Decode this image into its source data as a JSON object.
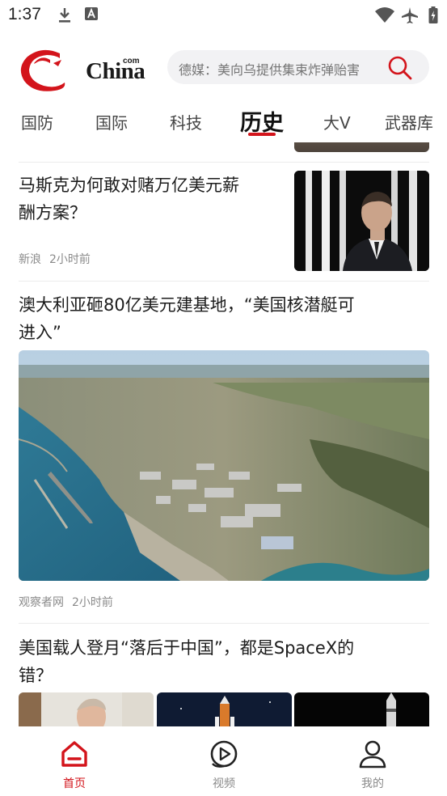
{
  "status_bar": {
    "time": "1:37",
    "icons": [
      "download-icon",
      "a-icon",
      "wifi-icon",
      "airplane-icon",
      "battery-icon"
    ]
  },
  "header": {
    "logo_text": "China",
    "logo_com": "com",
    "search_placeholder": "德媒：美向乌提供集束炸弹贻害",
    "accent_color": "#d3141b"
  },
  "tabs": [
    {
      "label": "国防",
      "active": false
    },
    {
      "label": "国际",
      "active": false
    },
    {
      "label": "科技",
      "active": false
    },
    {
      "label": "历史",
      "active": true
    },
    {
      "label": "大V",
      "active": false
    },
    {
      "label": "武器库",
      "active": false
    }
  ],
  "articles": [
    {
      "title_lines": [
        "马斯克为何敢对赌万亿美元薪",
        "酬方案？"
      ],
      "source": "新浪",
      "time": "2小时前",
      "image": "musk-portrait"
    },
    {
      "title_lines": [
        "澳大利亚砸80亿美元建基地，“美国核潜艇可",
        "进入”"
      ],
      "source": "观察者网",
      "time": "2小时前",
      "image": "naval-base-aerial"
    },
    {
      "title_lines": [
        "美国载人登月“落后于中国”，都是SpaceX的",
        "错？"
      ],
      "images": [
        "person-photo",
        "rocket-launch",
        "rocket-night"
      ]
    }
  ],
  "bottom_nav": [
    {
      "label": "首页",
      "icon": "home-icon",
      "active": true
    },
    {
      "label": "视频",
      "icon": "video-play-icon",
      "active": false
    },
    {
      "label": "我的",
      "icon": "user-icon",
      "active": false
    }
  ]
}
